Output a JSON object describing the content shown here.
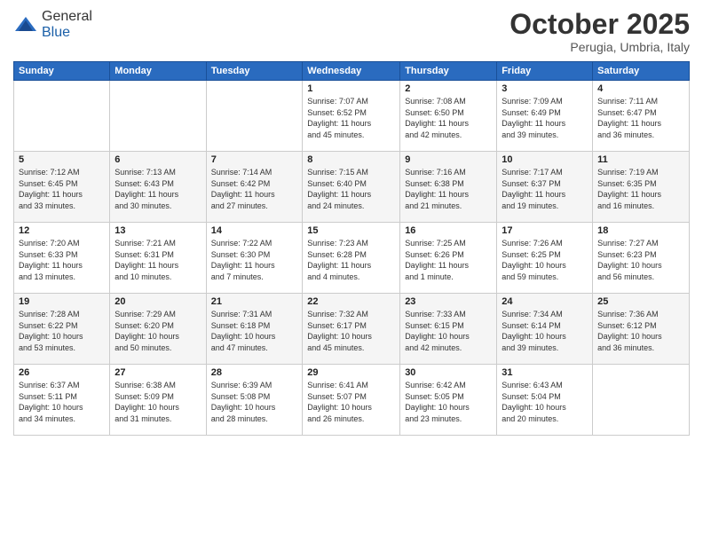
{
  "logo": {
    "general": "General",
    "blue": "Blue"
  },
  "header": {
    "month": "October 2025",
    "location": "Perugia, Umbria, Italy"
  },
  "weekdays": [
    "Sunday",
    "Monday",
    "Tuesday",
    "Wednesday",
    "Thursday",
    "Friday",
    "Saturday"
  ],
  "weeks": [
    [
      {
        "day": "",
        "info": ""
      },
      {
        "day": "",
        "info": ""
      },
      {
        "day": "",
        "info": ""
      },
      {
        "day": "1",
        "info": "Sunrise: 7:07 AM\nSunset: 6:52 PM\nDaylight: 11 hours\nand 45 minutes."
      },
      {
        "day": "2",
        "info": "Sunrise: 7:08 AM\nSunset: 6:50 PM\nDaylight: 11 hours\nand 42 minutes."
      },
      {
        "day": "3",
        "info": "Sunrise: 7:09 AM\nSunset: 6:49 PM\nDaylight: 11 hours\nand 39 minutes."
      },
      {
        "day": "4",
        "info": "Sunrise: 7:11 AM\nSunset: 6:47 PM\nDaylight: 11 hours\nand 36 minutes."
      }
    ],
    [
      {
        "day": "5",
        "info": "Sunrise: 7:12 AM\nSunset: 6:45 PM\nDaylight: 11 hours\nand 33 minutes."
      },
      {
        "day": "6",
        "info": "Sunrise: 7:13 AM\nSunset: 6:43 PM\nDaylight: 11 hours\nand 30 minutes."
      },
      {
        "day": "7",
        "info": "Sunrise: 7:14 AM\nSunset: 6:42 PM\nDaylight: 11 hours\nand 27 minutes."
      },
      {
        "day": "8",
        "info": "Sunrise: 7:15 AM\nSunset: 6:40 PM\nDaylight: 11 hours\nand 24 minutes."
      },
      {
        "day": "9",
        "info": "Sunrise: 7:16 AM\nSunset: 6:38 PM\nDaylight: 11 hours\nand 21 minutes."
      },
      {
        "day": "10",
        "info": "Sunrise: 7:17 AM\nSunset: 6:37 PM\nDaylight: 11 hours\nand 19 minutes."
      },
      {
        "day": "11",
        "info": "Sunrise: 7:19 AM\nSunset: 6:35 PM\nDaylight: 11 hours\nand 16 minutes."
      }
    ],
    [
      {
        "day": "12",
        "info": "Sunrise: 7:20 AM\nSunset: 6:33 PM\nDaylight: 11 hours\nand 13 minutes."
      },
      {
        "day": "13",
        "info": "Sunrise: 7:21 AM\nSunset: 6:31 PM\nDaylight: 11 hours\nand 10 minutes."
      },
      {
        "day": "14",
        "info": "Sunrise: 7:22 AM\nSunset: 6:30 PM\nDaylight: 11 hours\nand 7 minutes."
      },
      {
        "day": "15",
        "info": "Sunrise: 7:23 AM\nSunset: 6:28 PM\nDaylight: 11 hours\nand 4 minutes."
      },
      {
        "day": "16",
        "info": "Sunrise: 7:25 AM\nSunset: 6:26 PM\nDaylight: 11 hours\nand 1 minute."
      },
      {
        "day": "17",
        "info": "Sunrise: 7:26 AM\nSunset: 6:25 PM\nDaylight: 10 hours\nand 59 minutes."
      },
      {
        "day": "18",
        "info": "Sunrise: 7:27 AM\nSunset: 6:23 PM\nDaylight: 10 hours\nand 56 minutes."
      }
    ],
    [
      {
        "day": "19",
        "info": "Sunrise: 7:28 AM\nSunset: 6:22 PM\nDaylight: 10 hours\nand 53 minutes."
      },
      {
        "day": "20",
        "info": "Sunrise: 7:29 AM\nSunset: 6:20 PM\nDaylight: 10 hours\nand 50 minutes."
      },
      {
        "day": "21",
        "info": "Sunrise: 7:31 AM\nSunset: 6:18 PM\nDaylight: 10 hours\nand 47 minutes."
      },
      {
        "day": "22",
        "info": "Sunrise: 7:32 AM\nSunset: 6:17 PM\nDaylight: 10 hours\nand 45 minutes."
      },
      {
        "day": "23",
        "info": "Sunrise: 7:33 AM\nSunset: 6:15 PM\nDaylight: 10 hours\nand 42 minutes."
      },
      {
        "day": "24",
        "info": "Sunrise: 7:34 AM\nSunset: 6:14 PM\nDaylight: 10 hours\nand 39 minutes."
      },
      {
        "day": "25",
        "info": "Sunrise: 7:36 AM\nSunset: 6:12 PM\nDaylight: 10 hours\nand 36 minutes."
      }
    ],
    [
      {
        "day": "26",
        "info": "Sunrise: 6:37 AM\nSunset: 5:11 PM\nDaylight: 10 hours\nand 34 minutes."
      },
      {
        "day": "27",
        "info": "Sunrise: 6:38 AM\nSunset: 5:09 PM\nDaylight: 10 hours\nand 31 minutes."
      },
      {
        "day": "28",
        "info": "Sunrise: 6:39 AM\nSunset: 5:08 PM\nDaylight: 10 hours\nand 28 minutes."
      },
      {
        "day": "29",
        "info": "Sunrise: 6:41 AM\nSunset: 5:07 PM\nDaylight: 10 hours\nand 26 minutes."
      },
      {
        "day": "30",
        "info": "Sunrise: 6:42 AM\nSunset: 5:05 PM\nDaylight: 10 hours\nand 23 minutes."
      },
      {
        "day": "31",
        "info": "Sunrise: 6:43 AM\nSunset: 5:04 PM\nDaylight: 10 hours\nand 20 minutes."
      },
      {
        "day": "",
        "info": ""
      }
    ]
  ]
}
